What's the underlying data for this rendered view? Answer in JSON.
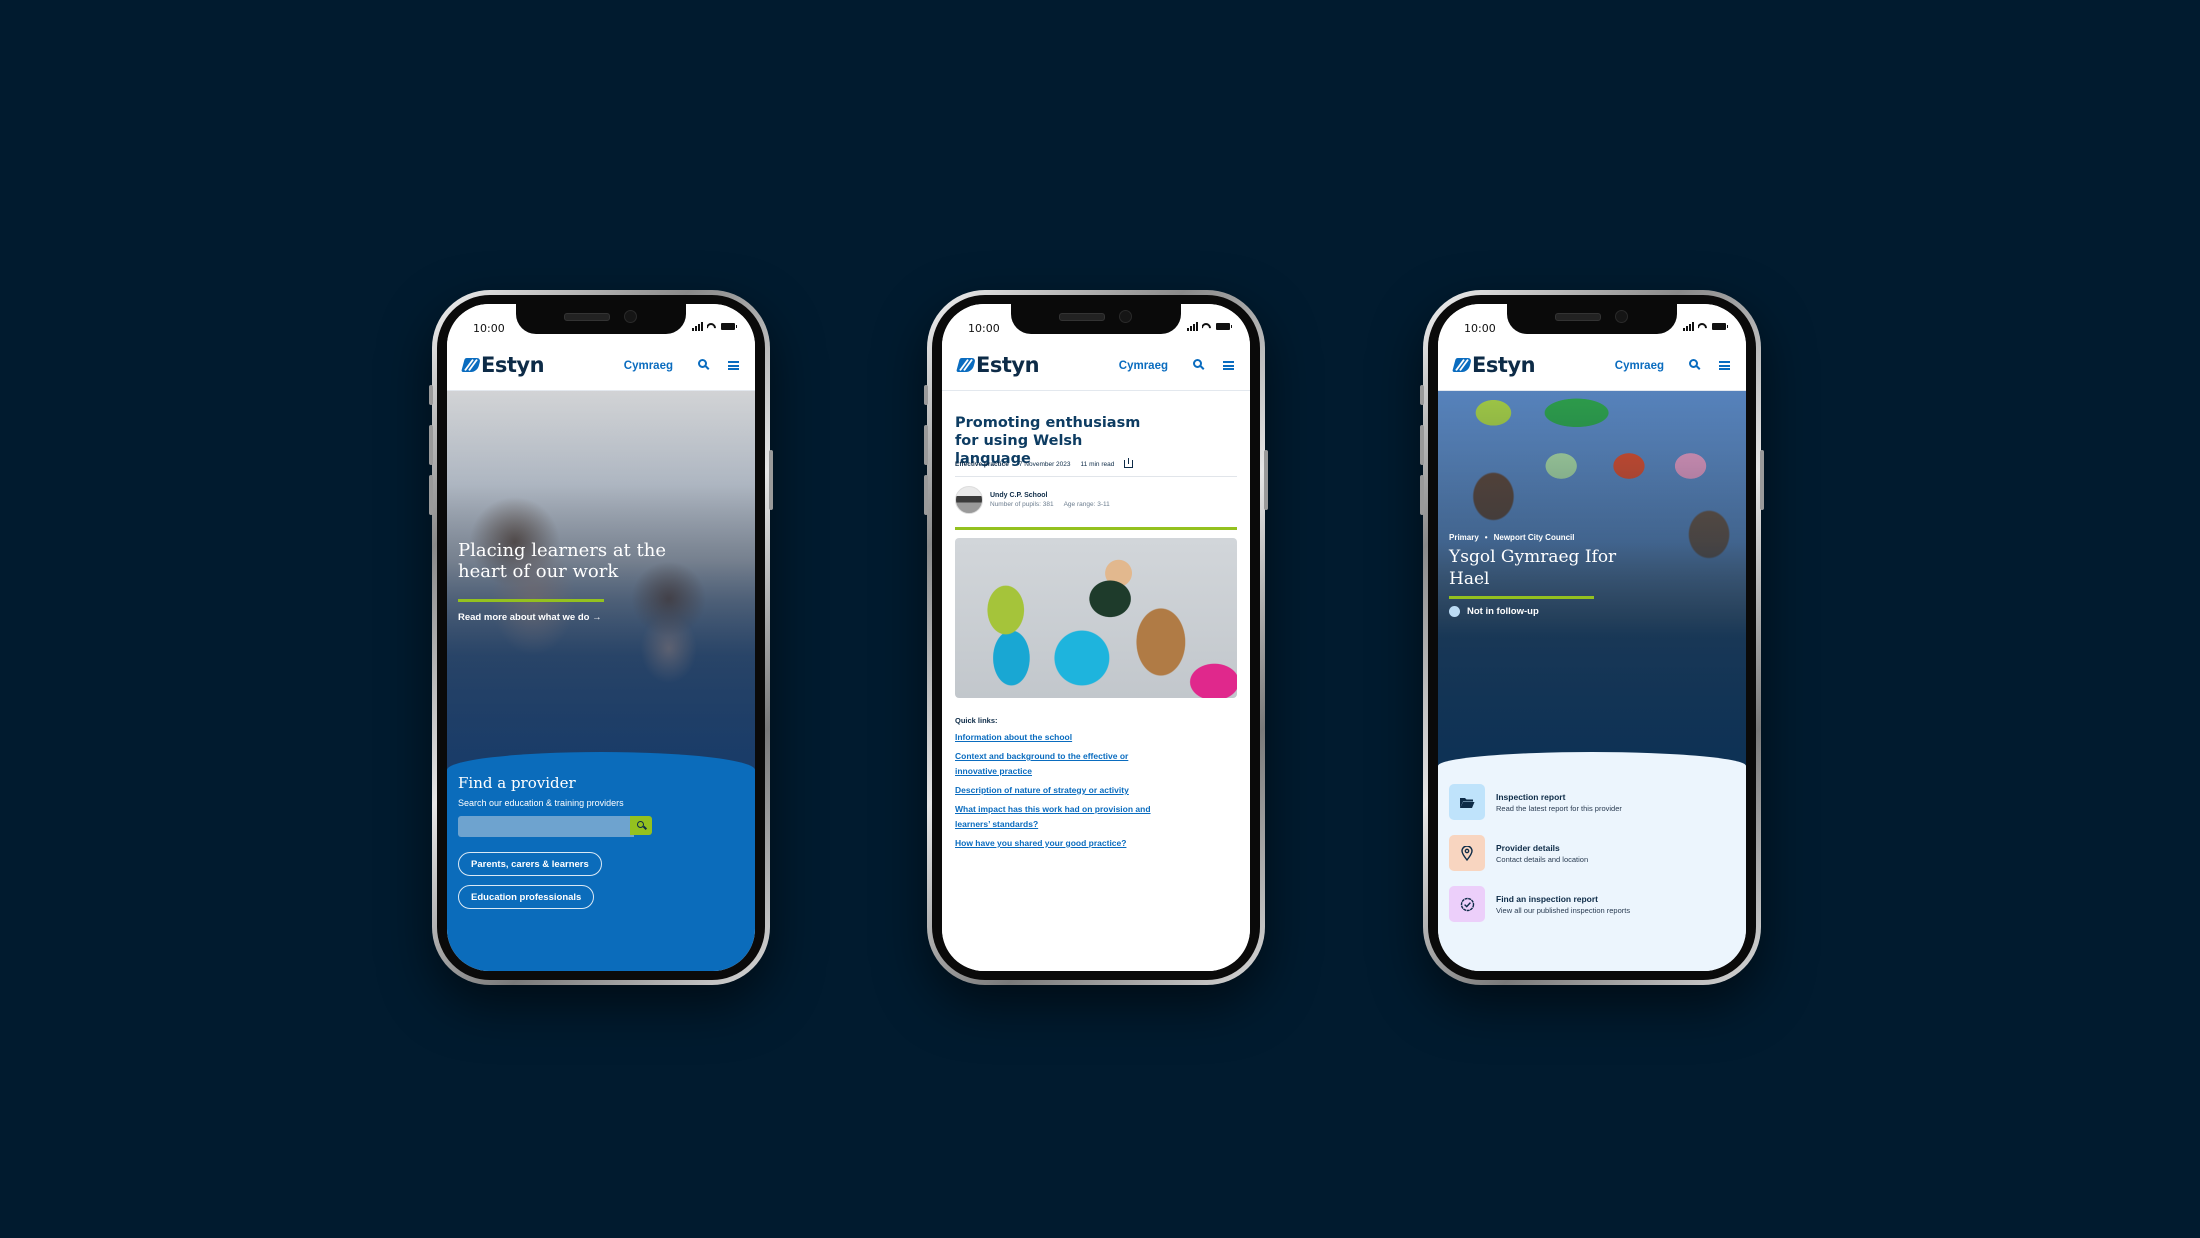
{
  "background_color": "#011b2f",
  "brand": {
    "logo_text": "Estyn",
    "primary_blue": "#0a6cbf",
    "navy": "#0d2b47",
    "accent_green": "#94c11f"
  },
  "status_bar": {
    "time": "10:00"
  },
  "header": {
    "language_link": "Cymraeg",
    "search_icon": "search-icon",
    "menu_icon": "hamburger-menu-icon"
  },
  "phone_home": {
    "hero": {
      "title": "Placing learners at the heart of our work",
      "read_more": "Read more about what we do →"
    },
    "find_provider": {
      "title": "Find a provider",
      "subtitle": "Search our education & training providers",
      "search_value": "",
      "search_button_icon": "search-icon",
      "buttons": [
        "Parents, carers & learners",
        "Education professionals"
      ]
    }
  },
  "phone_article": {
    "title": "Promoting enthusiasm for using Welsh language",
    "meta": {
      "type": "Effective practice",
      "date": "7 November 2023",
      "read_time": "11 min read",
      "share_icon": "share-icon"
    },
    "school": {
      "name": "Undy C.P. School",
      "pupils": "Number of pupils: 381",
      "age_range": "Age range: 3-11"
    },
    "quick_links_label": "Quick links:",
    "quick_links": [
      "Information about the school",
      "Context and background to the effective or innovative practice",
      "Description of nature of strategy or activity",
      "What impact has this work had on provision and learners’ standards?",
      "How have you shared your good practice?"
    ]
  },
  "phone_provider": {
    "sector": "Primary",
    "separator": "•",
    "authority": "Newport City Council",
    "title": "Ysgol Gymraeg Ifor Hael",
    "follow_up_status": "Not in follow-up",
    "cards": [
      {
        "title": "Inspection report",
        "desc": "Read the latest report for this provider",
        "icon": "folder-open-icon",
        "color": "#bfe3fb"
      },
      {
        "title": "Provider details",
        "desc": "Contact details and location",
        "icon": "map-pin-icon",
        "color": "#f8d5c0"
      },
      {
        "title": "Find an inspection report",
        "desc": "View all our published inspection reports",
        "icon": "badge-check-icon",
        "color": "#eccffa"
      }
    ]
  }
}
